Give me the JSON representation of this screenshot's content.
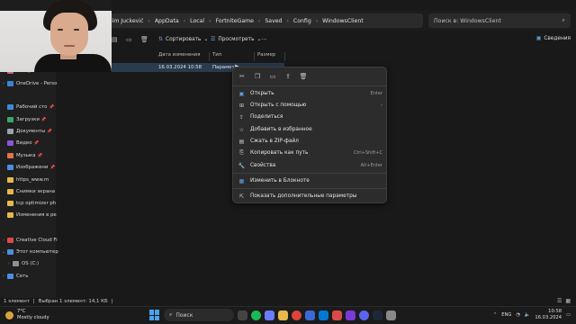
{
  "address_bar": {
    "crumbs": [
      "aksim Juckević",
      "AppData",
      "Local",
      "FortniteGame",
      "Saved",
      "Config",
      "WindowsClient"
    ],
    "search_placeholder": "Поиск в: WindowsClient"
  },
  "toolbar": {
    "sort_label": "Сортировать",
    "view_label": "Просмотреть",
    "details_label": "Сведения"
  },
  "columns": {
    "date": "Дата изменения",
    "type": "Тип",
    "size": "Размер"
  },
  "file": {
    "date": "16.03.2024 10:58",
    "type": "Параметр"
  },
  "sidebar": {
    "items": [
      {
        "label": "Галерея",
        "icon": "gallery-icon",
        "color": "#d65a8c"
      },
      {
        "label": "OneDrive - Perso",
        "icon": "cloud-icon",
        "color": "#3b82d6"
      },
      {
        "label": "Рабочий сто",
        "icon": "desktop-icon",
        "color": "#3f8ad8"
      },
      {
        "label": "Загрузки",
        "icon": "download-icon",
        "color": "#3aa56c"
      },
      {
        "label": "Документы",
        "icon": "document-icon",
        "color": "#9aa2ad"
      },
      {
        "label": "Видео",
        "icon": "video-icon",
        "color": "#8a56d6"
      },
      {
        "label": "Музыка",
        "icon": "music-icon",
        "color": "#e0734a"
      },
      {
        "label": "Изображени",
        "icon": "image-icon",
        "color": "#4a8fe0"
      },
      {
        "label": "https_www.m",
        "icon": "folder-icon",
        "color": "#e6b94a"
      },
      {
        "label": "Снимки экрана",
        "icon": "folder-icon",
        "color": "#e6b94a"
      },
      {
        "label": "tcp optimizer ph",
        "icon": "folder-icon",
        "color": "#e6b94a"
      },
      {
        "label": "Изменения в ре",
        "icon": "folder-icon",
        "color": "#e6b94a"
      },
      {
        "label": "Creative Cloud Fi",
        "icon": "creative-cloud-icon",
        "color": "#d94a4a"
      },
      {
        "label": "Этот компьютер",
        "icon": "computer-icon",
        "color": "#4a8fe0"
      },
      {
        "label": "OS (C:)",
        "icon": "drive-icon",
        "color": "#8a9099"
      },
      {
        "label": "Сеть",
        "icon": "network-icon",
        "color": "#4a8fe0"
      }
    ]
  },
  "context_menu": {
    "items": [
      {
        "label": "Открыть",
        "shortcut": "Enter",
        "icon": "open-icon"
      },
      {
        "label": "Открыть с помощью",
        "shortcut": "›",
        "icon": "open-with-icon"
      },
      {
        "label": "Поделиться",
        "shortcut": "",
        "icon": "share-icon"
      },
      {
        "label": "Добавить в избранное",
        "shortcut": "",
        "icon": "star-icon"
      },
      {
        "label": "Сжать в ZIP-файл",
        "shortcut": "",
        "icon": "zip-icon"
      },
      {
        "label": "Копировать как путь",
        "shortcut": "Ctrl+Shift+C",
        "icon": "copy-path-icon"
      },
      {
        "label": "Свойства",
        "shortcut": "Alt+Enter",
        "icon": "properties-icon"
      },
      {
        "label": "Изменить в Блокноте",
        "shortcut": "",
        "icon": "notepad-icon"
      },
      {
        "label": "Показать дополнительные параметры",
        "shortcut": "",
        "icon": "more-options-icon"
      }
    ]
  },
  "status": {
    "count": "1 элемент",
    "selected": "Выбран 1 элемент: 14,1 КБ"
  },
  "taskbar": {
    "temperature": "7°C",
    "weather": "Mostly cloudy",
    "search": "Поиск",
    "lang": "ENG",
    "time": "10:58",
    "date": "16.03.2024"
  }
}
